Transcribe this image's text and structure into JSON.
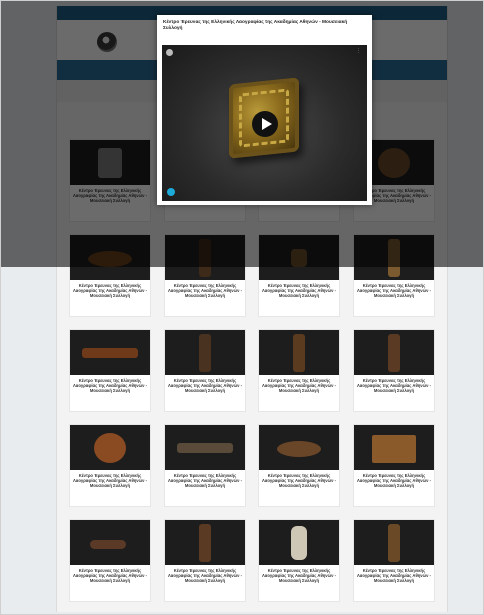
{
  "site": {
    "topbar_left": "",
    "topbar_right": "",
    "header_right": "",
    "breadcrumb_right": "",
    "section_label": ""
  },
  "modal": {
    "title": "Κέντρο Έρευνας της Ελληνικής Λαογραφίας της Ακαδημίας Αθηνών - Μουσειακή Συλλογή",
    "viewer_header": "",
    "play_label": "Play"
  },
  "card_title": "Κέντρο Έρευνας της Ελληνικής Λαογραφίας της Ακαδημίας Αθηνών - Μουσειακή Συλλογή",
  "card_subtitle": "",
  "grid": {
    "rows": 5,
    "cols": 4
  },
  "colors": {
    "topbar": "#1e5e86",
    "navbar": "#2a6f99",
    "overlay": "rgba(0,0,0,0.58)",
    "sketchfab_accent": "#1caad9"
  }
}
